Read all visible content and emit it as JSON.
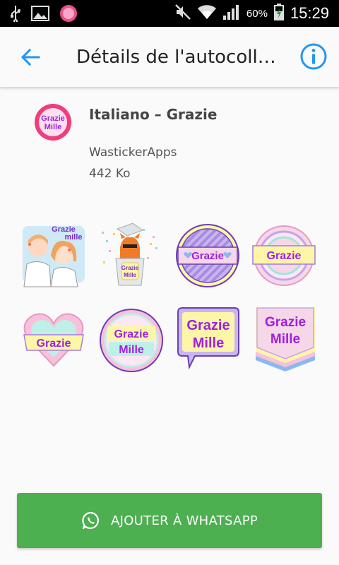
{
  "status_bar": {
    "battery_percent": "60%",
    "time": "15:29"
  },
  "app_bar": {
    "title": "Détails de l'autocoll…"
  },
  "pack": {
    "name": "Italiano – Grazie",
    "publisher": "WastickerApps",
    "size": "442 Ko",
    "icon_text_line1": "Grazie",
    "icon_text_line2": "Mille"
  },
  "stickers": [
    {
      "line1": "Grazie",
      "line2": "mille"
    },
    {
      "line1": "Grazie",
      "line2": "Mille"
    },
    {
      "line1": "Grazie"
    },
    {
      "line1": "Grazie"
    },
    {
      "line1": "Grazie"
    },
    {
      "line1": "Grazie",
      "line2": "Mille"
    },
    {
      "line1": "Grazie",
      "line2": "Mille"
    },
    {
      "line1": "Grazie",
      "line2": "Mille"
    }
  ],
  "actions": {
    "add_label": "AJOUTER À WHATSAPP"
  },
  "colors": {
    "accent_blue": "#2196f3",
    "button_green": "#4caf50",
    "sticker_purple": "#a01fe0",
    "sticker_pink": "#f7c7dc",
    "sticker_lavender": "#c9b5ef",
    "sticker_yellow": "#fdf6a8",
    "sticker_mint": "#bff0e8"
  }
}
